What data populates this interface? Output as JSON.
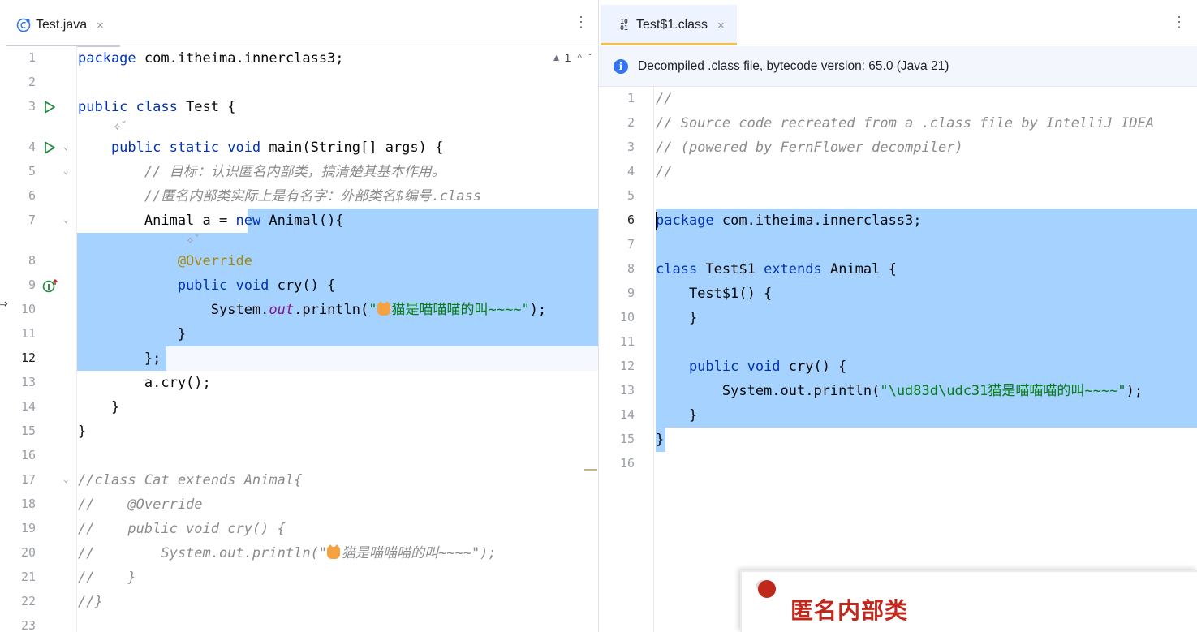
{
  "left": {
    "tab": {
      "title": "Test.java",
      "close": "×",
      "more": "⋮"
    },
    "warnings": {
      "count": "1",
      "up": "^",
      "down": "ˇ"
    },
    "lines": [
      {
        "n": "1"
      },
      {
        "n": "2"
      },
      {
        "n": "3"
      },
      {
        "n": "4"
      },
      {
        "n": "5"
      },
      {
        "n": "6"
      },
      {
        "n": "7"
      },
      {
        "n": ""
      },
      {
        "n": "8"
      },
      {
        "n": "9"
      },
      {
        "n": "10"
      },
      {
        "n": "11"
      },
      {
        "n": "12"
      },
      {
        "n": "13"
      },
      {
        "n": "14"
      },
      {
        "n": "15"
      },
      {
        "n": "16"
      },
      {
        "n": "17"
      },
      {
        "n": "18"
      },
      {
        "n": "19"
      },
      {
        "n": "20"
      },
      {
        "n": "21"
      },
      {
        "n": "22"
      },
      {
        "n": "23"
      }
    ],
    "code": {
      "l1_kw": "package",
      "l1_rest": " com.itheima.innerclass3;",
      "l3_kw": "public class",
      "l3_rest": " Test {",
      "l4_kw": "    public static void",
      "l4_rest": " main(String[] args) {",
      "l5": "        // 目标：认识匿名内部类，搞清楚其基本作用。",
      "l6": "        //匿名内部类实际上是有名字：外部类名$编号.class",
      "l7_a": "        Animal a = ",
      "l7_kw": "new",
      "l7_b": " Animal(){",
      "l8": "            @Override",
      "l9_kw": "            public void",
      "l9_rest": " cry() {",
      "l10_a": "                System.",
      "l10_fld": "out",
      "l10_b": ".println(",
      "l10_str": "\"",
      "l10_text": "猫是喵喵喵的叫~~~~\"",
      "l10_end": ");",
      "l11": "            }",
      "l12": "        };",
      "l13": "        a.cry();",
      "l14": "    }",
      "l15": "}",
      "l17": "//class Cat extends Animal{",
      "l18": "//    @Override",
      "l19": "//    public void cry() {",
      "l20_a": "//        System.out.println(\"",
      "l20_b": "猫是喵喵喵的叫~~~~\");",
      "l21": "//    }",
      "l22": "//}"
    }
  },
  "right": {
    "tab": {
      "title": "Test$1.class",
      "close": "×",
      "more": "⋮"
    },
    "banner": "Decompiled .class file, bytecode version: 65.0 (Java 21)",
    "lines": [
      "1",
      "2",
      "3",
      "4",
      "5",
      "6",
      "7",
      "8",
      "9",
      "10",
      "11",
      "12",
      "13",
      "14",
      "15",
      "16"
    ],
    "code": {
      "l1": "//",
      "l2": "// Source code recreated from a .class file by IntelliJ IDEA",
      "l3": "// (powered by FernFlower decompiler)",
      "l4": "//",
      "l6_kw": "package",
      "l6_rest": " com.itheima.innerclass3;",
      "l8_kw": "class",
      "l8_a": " Test$1 ",
      "l8_kw2": "extends",
      "l8_b": " Animal {",
      "l9": "    Test$1() {",
      "l10": "    }",
      "l12_kw": "    public void",
      "l12_rest": " cry() {",
      "l13_a": "        System.out.println(",
      "l13_str": "\"\\ud83d\\udc31猫是喵喵喵的叫~~~~\"",
      "l13_end": ");",
      "l14": "    }",
      "l15": "}"
    }
  },
  "overlay": {
    "title": "匿名内部类"
  },
  "colors": {
    "selection": "#a6d2ff",
    "keyword": "#0033b3",
    "comment": "#8c8c8c",
    "string": "#067d17",
    "annotation": "#9e880d",
    "accent": "#c0281b"
  }
}
